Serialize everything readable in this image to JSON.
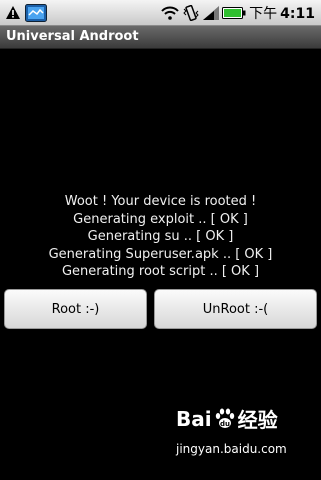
{
  "status_bar": {
    "time_prefix": "下午",
    "time": "4:11",
    "icons": [
      "warning-icon",
      "gallery-notification-icon",
      "wifi-icon",
      "vibrate-icon",
      "signal-icon",
      "battery-icon"
    ]
  },
  "app": {
    "title": "Universal Androot"
  },
  "messages": [
    "Woot ! Your device is rooted !",
    "Generating exploit .. [ OK ]",
    "Generating su .. [ OK ]",
    "Generating Superuser.apk .. [ OK ]",
    "Generating root script .. [ OK ]"
  ],
  "buttons": {
    "root": "Root :-)",
    "unroot": "UnRoot :-("
  },
  "watermark": {
    "brand": "Bai",
    "brand_suffix": "du",
    "product": "经验",
    "url": "jingyan.baidu.com"
  }
}
